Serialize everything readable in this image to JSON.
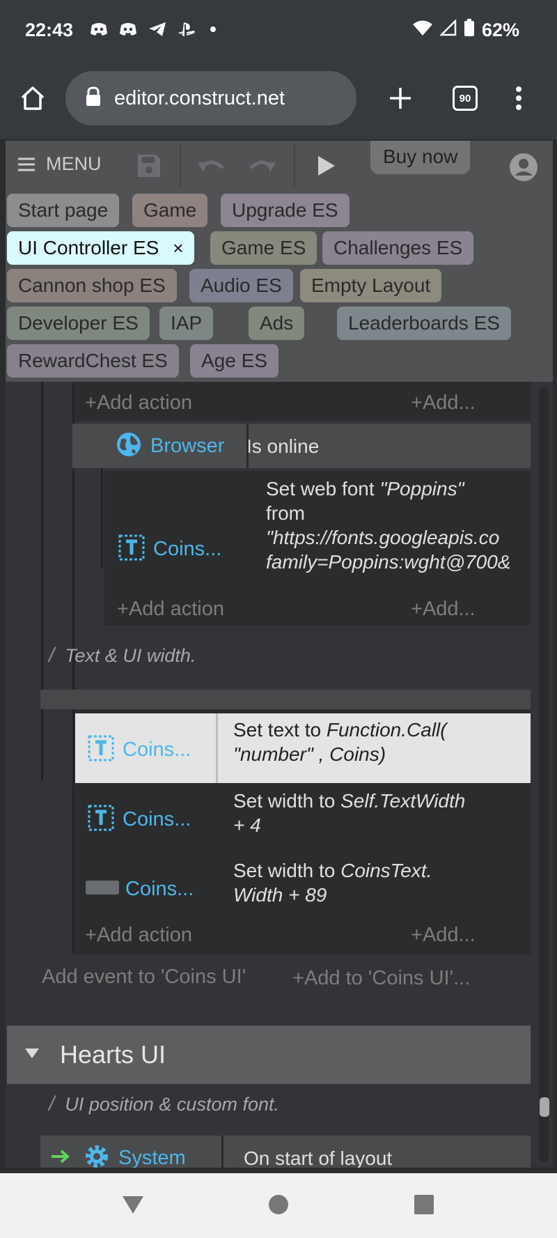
{
  "status": {
    "time": "22:43",
    "battery": "62%",
    "icons": [
      "discord-icon",
      "discord-icon",
      "telegram-icon",
      "playstation-icon",
      "dot-icon"
    ]
  },
  "browser": {
    "url": "editor.construct.net",
    "tab_count": "90"
  },
  "toolbar": {
    "menu_label": "MENU",
    "buy_label": "Buy now"
  },
  "tabs": [
    {
      "label": "Start page",
      "color": "#8c8d8f"
    },
    {
      "label": "Game",
      "color": "#8e8380"
    },
    {
      "label": "Upgrade ES",
      "color": "#8d8592"
    },
    {
      "label": "UI Controller ES",
      "color": "#d9fbff"
    },
    {
      "label": "Game ES",
      "color": "#868a7c"
    },
    {
      "label": "Challenges ES",
      "color": "#8a8491"
    },
    {
      "label": "Cannon shop ES",
      "color": "#8b827e"
    },
    {
      "label": "Audio ES",
      "color": "#7e8090"
    },
    {
      "label": "Empty Layout",
      "color": "#8d8a7e"
    },
    {
      "label": "Developer ES",
      "color": "#7f887f"
    },
    {
      "label": "IAP",
      "color": "#7f8786"
    },
    {
      "label": "Ads",
      "color": "#83887c"
    },
    {
      "label": "Leaderboards ES",
      "color": "#7e878c"
    },
    {
      "label": "RewardChest ES",
      "color": "#86818c"
    },
    {
      "label": "Age ES",
      "color": "#8a8290"
    }
  ],
  "tab_close": "×",
  "sheet": {
    "add_action": "Add action",
    "add_short": "Add...",
    "browser_cond": {
      "object": "Browser",
      "condition": "Is online"
    },
    "webfont_action": {
      "object": "Coins...",
      "text": "Set web font",
      "font": "\"Poppins\"",
      "from": "from",
      "url1": "\"https://fonts.googleapis.co",
      "url2": "family=Poppins:wght@700&"
    },
    "comment1": "Text & UI width.",
    "action1": {
      "object": "Coins...",
      "text": "Set text to",
      "expr1": "Function.Call(",
      "expr2": "\"number\" , Coins)"
    },
    "action2": {
      "object": "Coins...",
      "text": "Set width to",
      "expr1": "Self.TextWidth",
      "expr2": "+ 4"
    },
    "action3": {
      "object": "Coins...",
      "text": "Set width to",
      "expr1": "CoinsText.",
      "expr2": "Width + 89"
    },
    "add_event": "Add event to 'Coins UI'",
    "add_to": "Add to 'Coins UI'...",
    "group_title": "Hearts UI",
    "comment2": "UI position & custom font.",
    "system_event": {
      "object": "System",
      "condition": "On start of layout"
    }
  },
  "colors": {
    "accent": "#4db7ea",
    "trigger_arrow": "#5fd35f"
  }
}
